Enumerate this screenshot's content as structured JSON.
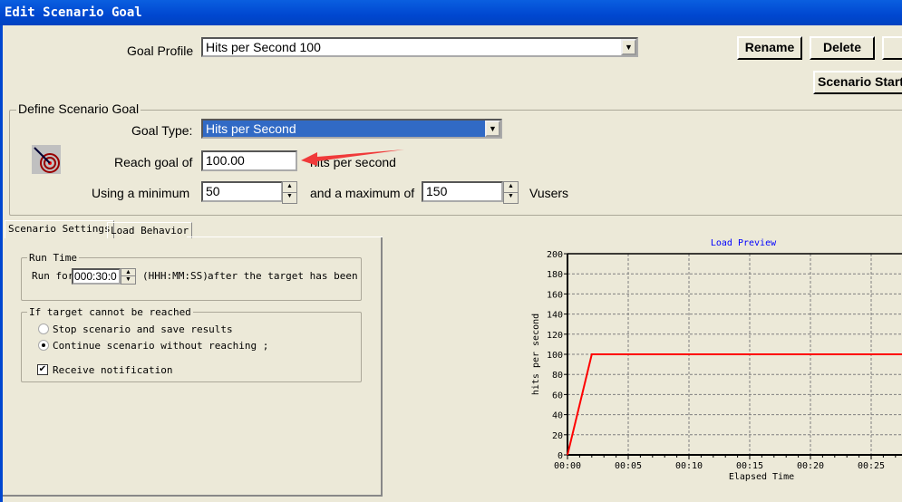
{
  "window": {
    "title": "Edit Scenario Goal"
  },
  "goal_profile": {
    "label": "Goal Profile",
    "value": "Hits per Second 100",
    "rename": "Rename",
    "delete": "Delete",
    "scenario_start": "Scenario Start"
  },
  "define": {
    "legend": "Define Scenario Goal",
    "goal_type_label": "Goal Type:",
    "goal_type_value": "Hits per Second",
    "reach_label": "Reach goal of",
    "reach_value": "100.00",
    "reach_unit": "hits per second",
    "min_label": "Using a minimum",
    "min_value": "50",
    "max_label": "and a maximum of",
    "max_value": "150",
    "vusers": "Vusers"
  },
  "tabs": [
    {
      "label": "Scenario Settings",
      "active": true
    },
    {
      "label": "Load Behavior",
      "active": false
    }
  ],
  "run_time": {
    "legend": "Run Time",
    "run_for": "Run for",
    "value": "000:30:0",
    "format": "(HHH:MM:SS)",
    "after": "after the target has been"
  },
  "unreached": {
    "legend": "If target cannot be reached",
    "options": [
      {
        "label": "Stop scenario and save results",
        "selected": false
      },
      {
        "label": "Continue scenario without reaching ;",
        "selected": true
      }
    ],
    "notify": {
      "label": "Receive notification",
      "checked": true
    }
  },
  "chart_data": {
    "type": "line",
    "title": "Load Preview",
    "xlabel": "Elapsed Time",
    "ylabel": "hits per second",
    "ylim": [
      0,
      200
    ],
    "yticks": [
      "0",
      "20",
      "40",
      "60",
      "80",
      "100",
      "120",
      "140",
      "160",
      "180",
      "200"
    ],
    "xticks": [
      "00:00",
      "00:05",
      "00:10",
      "00:15",
      "00:20",
      "00:25"
    ],
    "grid": true,
    "series": [
      {
        "color": "#FF0000",
        "x_minutes": [
          0,
          2,
          30
        ],
        "y": [
          0,
          100,
          100
        ]
      }
    ]
  }
}
